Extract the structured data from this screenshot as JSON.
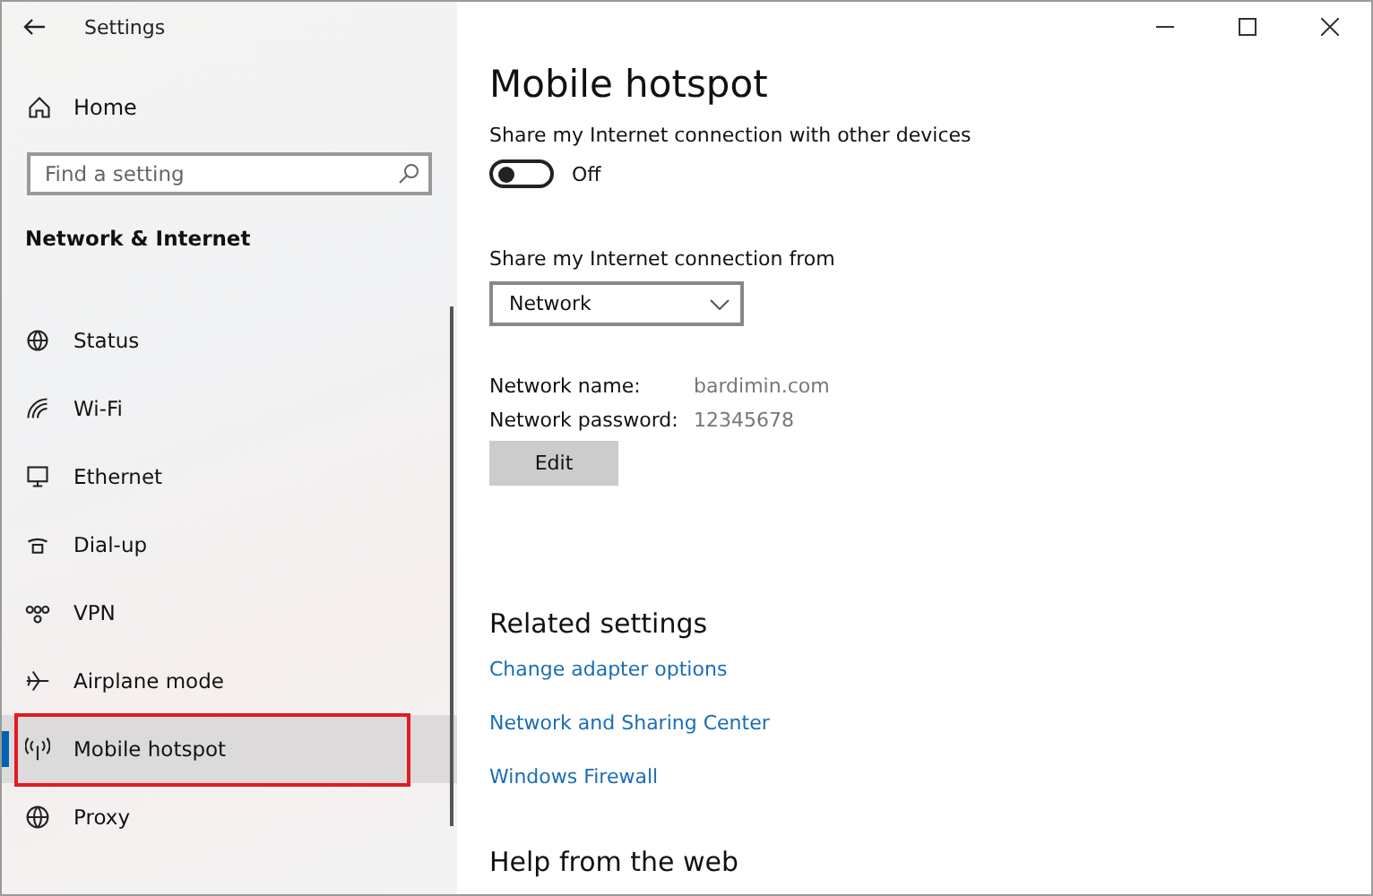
{
  "window": {
    "title": "Settings"
  },
  "sidebar": {
    "home": "Home",
    "search": {
      "placeholder": "Find a setting"
    },
    "section": "Network & Internet",
    "items": [
      {
        "label": "Status",
        "kind": "status",
        "selected": false
      },
      {
        "label": "Wi-Fi",
        "kind": "wifi",
        "selected": false
      },
      {
        "label": "Ethernet",
        "kind": "ethernet",
        "selected": false
      },
      {
        "label": "Dial-up",
        "kind": "dialup",
        "selected": false
      },
      {
        "label": "VPN",
        "kind": "vpn",
        "selected": false
      },
      {
        "label": "Airplane mode",
        "kind": "airplane",
        "selected": false
      },
      {
        "label": "Mobile hotspot",
        "kind": "hotspot",
        "selected": true
      },
      {
        "label": "Proxy",
        "kind": "proxy",
        "selected": false
      }
    ]
  },
  "page": {
    "title": "Mobile hotspot",
    "share_label": "Share my Internet connection with other devices",
    "toggle": {
      "on": false,
      "label": "Off"
    },
    "from_label": "Share my Internet connection from",
    "from_value": "Network",
    "fields": [
      {
        "label": "Network name:",
        "value": "bardimin.com"
      },
      {
        "label": "Network password:",
        "value": "12345678"
      }
    ],
    "edit_button": "Edit",
    "related_title": "Related settings",
    "links": [
      "Change adapter options",
      "Network and Sharing Center",
      "Windows Firewall"
    ],
    "help_title": "Help from the web"
  }
}
